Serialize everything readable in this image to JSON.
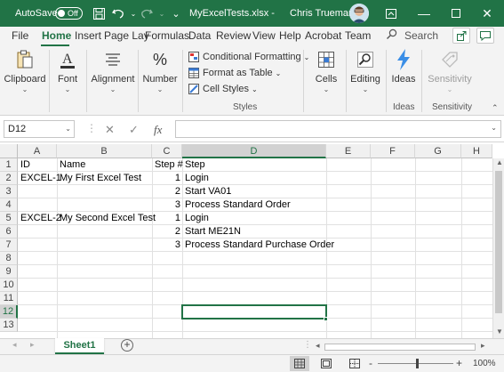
{
  "titlebar": {
    "autosave_label": "AutoSave",
    "autosave_state": "Off",
    "filename": "MyExcelTests.xlsx  -",
    "user_name": "Chris Trueman"
  },
  "tabs": [
    "File",
    "Home",
    "Insert",
    "Page Lay",
    "Formulas",
    "Data",
    "Review",
    "View",
    "Help",
    "Acrobat",
    "Team"
  ],
  "search_placeholder": "Search",
  "ribbon": {
    "clipboard": "Clipboard",
    "font": "Font",
    "alignment": "Alignment",
    "number": "Number",
    "number_symbol": "%",
    "conditional_formatting": "Conditional Formatting",
    "format_as_table": "Format as Table",
    "cell_styles": "Cell Styles",
    "styles_group": "Styles",
    "cells": "Cells",
    "editing": "Editing",
    "ideas": "Ideas",
    "ideas_group": "Ideas",
    "sensitivity": "Sensitivity",
    "sensitivity_group": "Sensitivity"
  },
  "formula_bar": {
    "name_box": "D12",
    "fx": "fx",
    "formula": ""
  },
  "columns": [
    "A",
    "B",
    "C",
    "D",
    "E",
    "F",
    "G",
    "H"
  ],
  "row_numbers": [
    "1",
    "2",
    "3",
    "4",
    "5",
    "6",
    "7",
    "8",
    "9",
    "10",
    "11",
    "12",
    "13"
  ],
  "rows": [
    [
      "ID",
      "Name",
      "Step #",
      "Step"
    ],
    [
      "EXCEL-1",
      "My First Excel Test",
      "1",
      "Login"
    ],
    [
      "",
      "",
      "2",
      "Start VA01"
    ],
    [
      "",
      "",
      "3",
      "Process Standard Order"
    ],
    [
      "EXCEL-2",
      "My Second Excel Test",
      "1",
      "Login"
    ],
    [
      "",
      "",
      "2",
      "Start ME21N"
    ],
    [
      "",
      "",
      "3",
      "Process Standard Purchase Order"
    ]
  ],
  "sheet_tab": "Sheet1",
  "status": {
    "zoom": "100%",
    "minus": "-",
    "plus": "+"
  },
  "colors": {
    "accent": "#217346"
  }
}
